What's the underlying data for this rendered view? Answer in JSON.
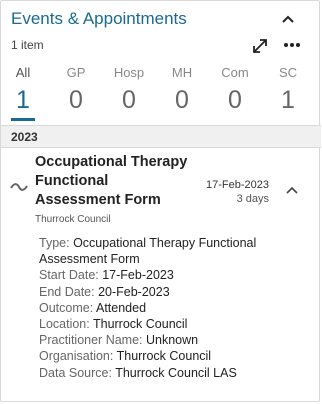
{
  "header": {
    "title": "Events & Appointments",
    "count": "1 item"
  },
  "tabs": [
    {
      "label": "All",
      "count": "1",
      "active": true
    },
    {
      "label": "GP",
      "count": "0"
    },
    {
      "label": "Hosp",
      "count": "0"
    },
    {
      "label": "MH",
      "count": "0"
    },
    {
      "label": "Com",
      "count": "0"
    },
    {
      "label": "SC",
      "count": "1"
    }
  ],
  "year": "2023",
  "event": {
    "title": "Occupational Therapy Functional Assessment Form",
    "organisation": "Thurrock Council",
    "date": "17-Feb-2023",
    "duration": "3 days",
    "details": [
      {
        "key": "Type:",
        "value": "Occupational Therapy Functional Assessment Form"
      },
      {
        "key": "Start Date:",
        "value": "17-Feb-2023"
      },
      {
        "key": "End Date:",
        "value": "20-Feb-2023"
      },
      {
        "key": "Outcome:",
        "value": "Attended"
      },
      {
        "key": "Location:",
        "value": "Thurrock Council"
      },
      {
        "key": "Practitioner Name:",
        "value": "Unknown"
      },
      {
        "key": "Organisation:",
        "value": "Thurrock Council"
      },
      {
        "key": "Data Source:",
        "value": "Thurrock Council LAS"
      }
    ]
  },
  "colors": {
    "accent": "#1a6a93",
    "muted": "#888888",
    "divider": "#d9d9d9",
    "year_bar": "#f0f0f0"
  },
  "icons": {
    "collapse": "chevron-up-icon",
    "expand": "expand-arrows-icon",
    "more": "more-dots-icon",
    "event": "wave-icon",
    "event_toggle": "chevron-up-icon"
  }
}
